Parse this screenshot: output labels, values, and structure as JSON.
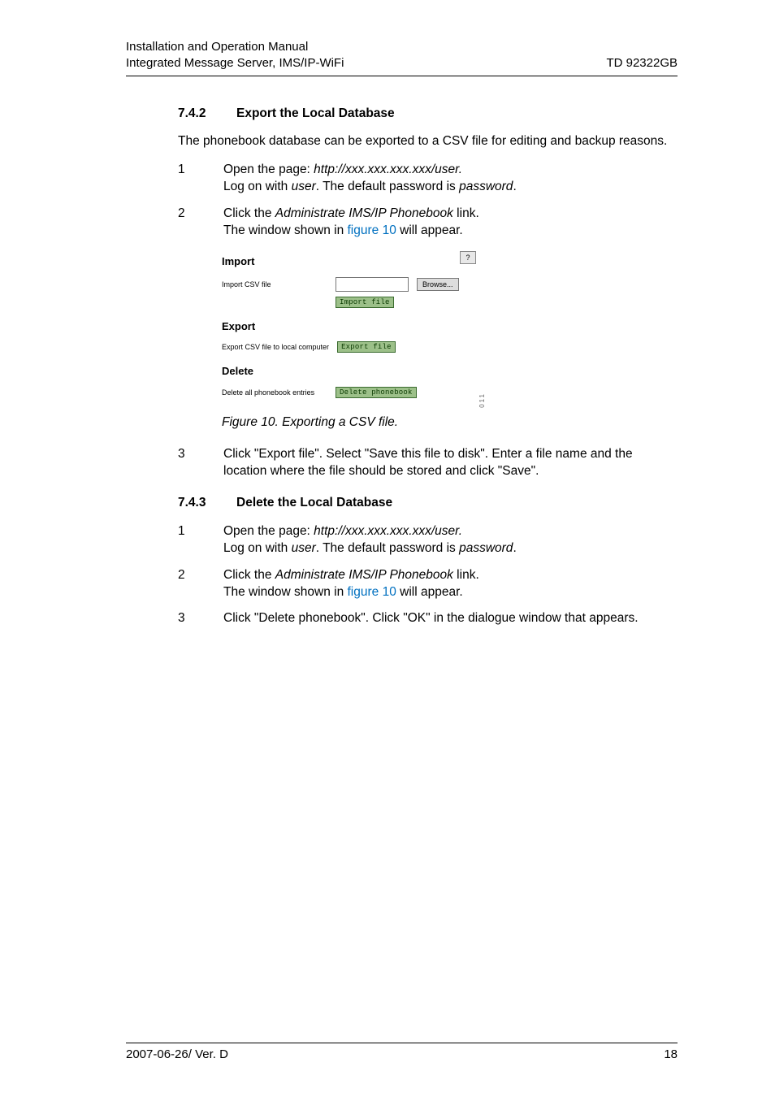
{
  "header": {
    "line1": "Installation and Operation Manual",
    "line2": "Integrated Message Server, IMS/IP-WiFi",
    "right": "TD 92322GB"
  },
  "section742": {
    "num": "7.4.2",
    "title": "Export the Local Database",
    "intro": "The phonebook database can be exported to a CSV file for editing and backup reasons.",
    "step1": {
      "n": "1",
      "a": "Open the page: ",
      "url": "http://xxx.xxx.xxx.xxx/user.",
      "b": "Log on with ",
      "user": "user",
      "c": ". The default password is ",
      "pw": "password",
      "d": "."
    },
    "step2": {
      "n": "2",
      "a": "Click the ",
      "link": "Administrate IMS/IP Phonebook",
      "b": " link.",
      "c": "The window shown in ",
      "figref": "figure 10",
      "d": " will appear."
    },
    "step3": {
      "n": "3",
      "text": "Click \"Export file\". Select \"Save this file to disk\". Enter a file name and the location where the file should be stored and click \"Save\"."
    }
  },
  "figure": {
    "import_h": "Import",
    "import_lbl": "Import CSV file",
    "browse": "Browse...",
    "import_btn": "Import file",
    "export_h": "Export",
    "export_lbl": "Export CSV file to local computer",
    "export_btn": "Export file",
    "delete_h": "Delete",
    "delete_lbl": "Delete all phonebook entries",
    "delete_btn": "Delete phonebook",
    "help": "?",
    "side": "011",
    "caption": "Figure 10. Exporting a CSV file."
  },
  "section743": {
    "num": "7.4.3",
    "title": "Delete the Local Database",
    "step1": {
      "n": "1",
      "a": "Open the page: ",
      "url": "http://xxx.xxx.xxx.xxx/user.",
      "b": "Log on with ",
      "user": "user",
      "c": ". The default password is ",
      "pw": "password",
      "d": "."
    },
    "step2": {
      "n": "2",
      "a": "Click the ",
      "link": "Administrate IMS/IP Phonebook",
      "b": " link.",
      "c": "The window shown in ",
      "figref": "figure 10",
      "d": " will appear."
    },
    "step3": {
      "n": "3",
      "text": "Click \"Delete phonebook\". Click \"OK\" in the dialogue window that appears."
    }
  },
  "footer": {
    "left": "2007-06-26/ Ver. D",
    "right": "18"
  }
}
